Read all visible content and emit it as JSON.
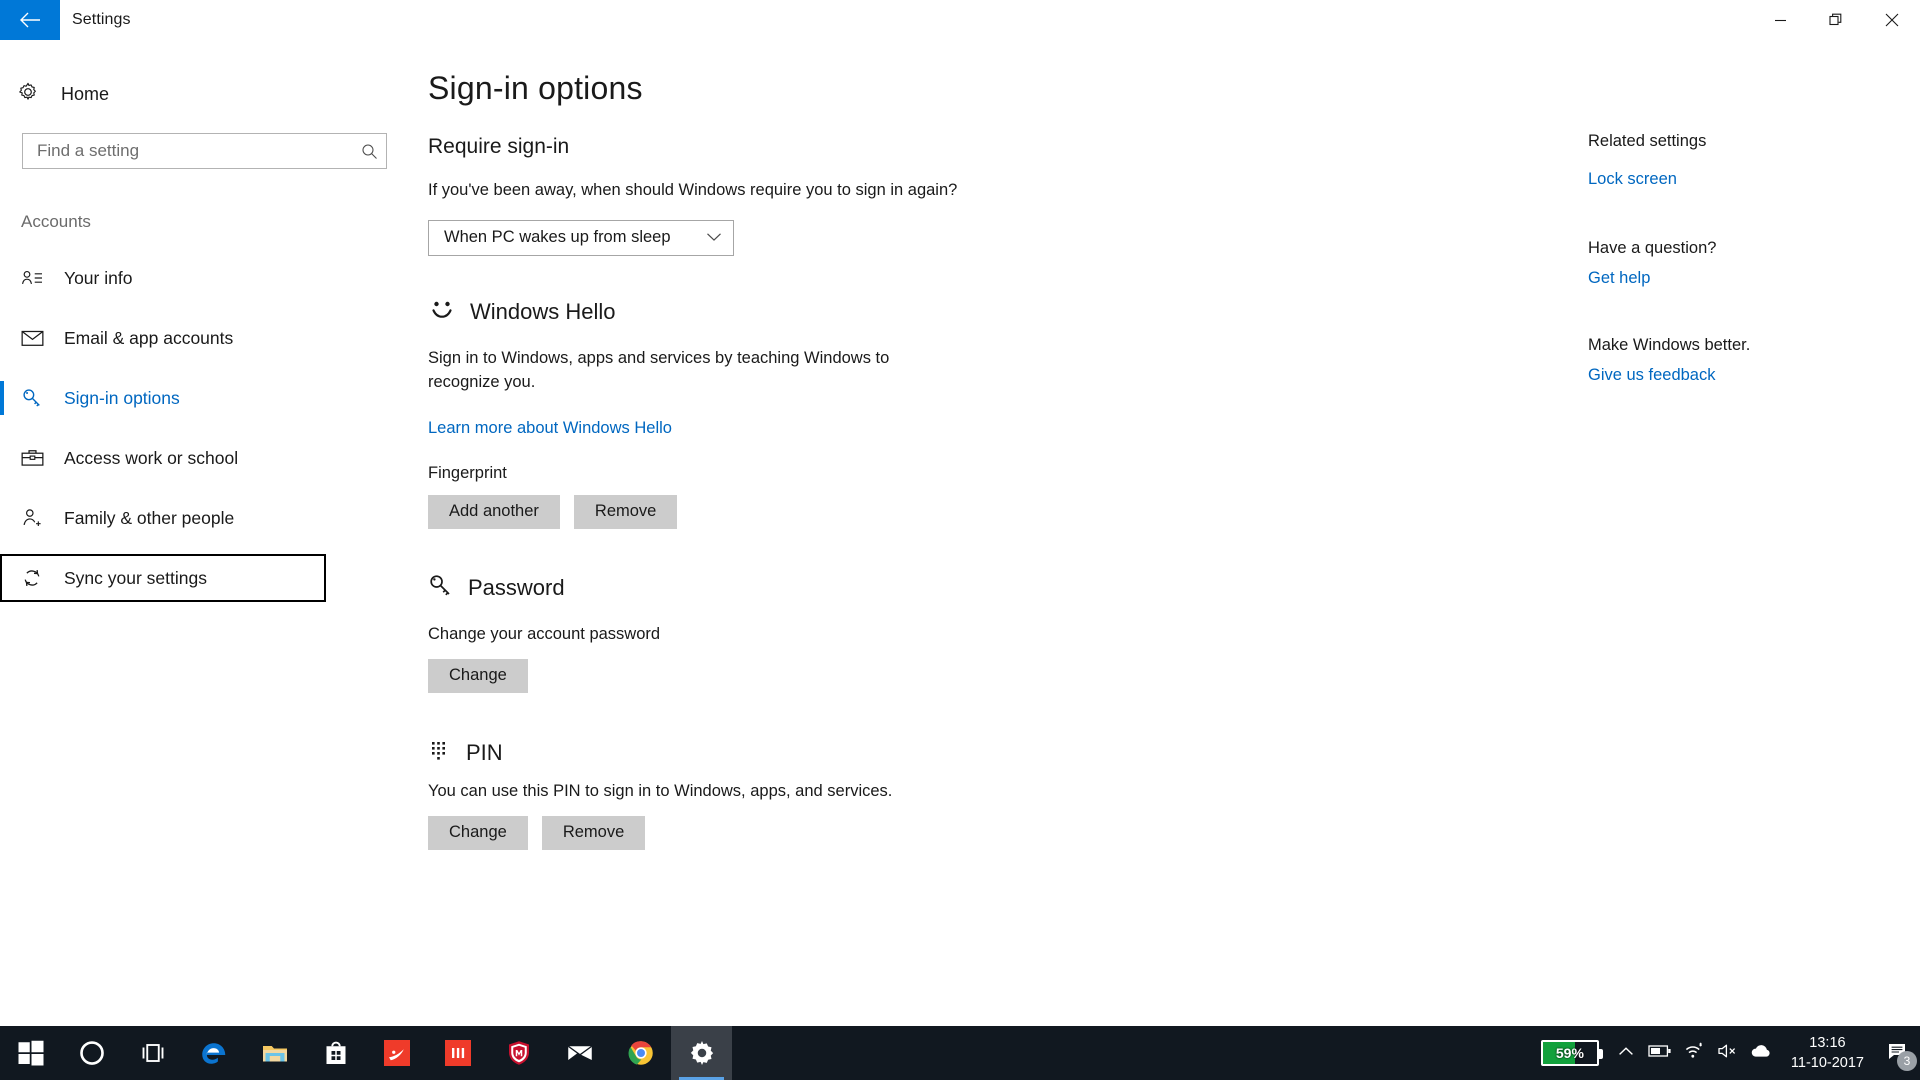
{
  "window": {
    "title": "Settings",
    "back_icon": "back-arrow-icon",
    "controls": {
      "minimize": "minimize-icon",
      "restore": "restore-icon",
      "close": "close-icon"
    },
    "accent_color": "#0078d7"
  },
  "sidebar": {
    "home_label": "Home",
    "search": {
      "placeholder": "Find a setting",
      "value": ""
    },
    "section_label": "Accounts",
    "items": [
      {
        "label": "Your info",
        "icon": "contact-card-icon",
        "active": false,
        "focused": false
      },
      {
        "label": "Email & app accounts",
        "icon": "envelope-icon",
        "active": false,
        "focused": false
      },
      {
        "label": "Sign-in options",
        "icon": "key-icon",
        "active": true,
        "focused": false
      },
      {
        "label": "Access work or school",
        "icon": "briefcase-icon",
        "active": false,
        "focused": false
      },
      {
        "label": "Family & other people",
        "icon": "person-add-icon",
        "active": false,
        "focused": false
      },
      {
        "label": "Sync your settings",
        "icon": "sync-refresh-icon",
        "active": false,
        "focused": true
      }
    ]
  },
  "main": {
    "page_title": "Sign-in options",
    "require_signin": {
      "heading": "Require sign-in",
      "description": "If you've been away, when should Windows require you to sign in again?",
      "dropdown_value": "When PC wakes up from sleep"
    },
    "windows_hello": {
      "heading": "Windows Hello",
      "icon": "smiley-face-icon",
      "description": "Sign in to Windows, apps and services by teaching Windows to recognize you.",
      "link": "Learn more about Windows Hello",
      "fingerprint_label": "Fingerprint",
      "add_button": "Add another",
      "remove_button": "Remove"
    },
    "password": {
      "heading": "Password",
      "icon": "key-icon",
      "description": "Change your account password",
      "change_button": "Change"
    },
    "pin": {
      "heading": "PIN",
      "icon": "keypad-dots-icon",
      "description": "You can use this PIN to sign in to Windows, apps, and services.",
      "change_button": "Change",
      "remove_button": "Remove"
    }
  },
  "rail": {
    "related_settings_heading": "Related settings",
    "lock_screen_link": "Lock screen",
    "question_heading": "Have a question?",
    "get_help_link": "Get help",
    "feedback_heading": "Make Windows better.",
    "feedback_link": "Give us feedback"
  },
  "taskbar": {
    "apps": [
      {
        "name": "start-button",
        "icon": "windows-logo-icon"
      },
      {
        "name": "cortana-button",
        "icon": "circle-icon"
      },
      {
        "name": "task-view-button",
        "icon": "task-view-icon"
      },
      {
        "name": "edge-taskbar-icon",
        "icon": "edge-icon"
      },
      {
        "name": "file-explorer-taskbar-icon",
        "icon": "folder-icon"
      },
      {
        "name": "microsoft-store-taskbar-icon",
        "icon": "store-bag-icon"
      },
      {
        "name": "red-app-one-taskbar-icon",
        "icon": "red-swoosh-icon"
      },
      {
        "name": "red-app-two-taskbar-icon",
        "icon": "red-bars-icon"
      },
      {
        "name": "mcafee-taskbar-icon",
        "icon": "shield-icon"
      },
      {
        "name": "mail-taskbar-icon",
        "icon": "envelope-icon"
      },
      {
        "name": "chrome-taskbar-icon",
        "icon": "chrome-icon"
      },
      {
        "name": "settings-taskbar-icon",
        "icon": "gear-icon",
        "active": true
      }
    ],
    "tray": {
      "battery_percent": "59%",
      "battery_level": 59,
      "show_hidden_icon": "chevron-up-icon",
      "battery_icon": "battery-icon",
      "network_icon": "wifi-icon",
      "volume_icon": "speaker-muted-icon",
      "onedrive_icon": "cloud-icon",
      "time": "13:16",
      "date": "11-10-2017",
      "action_center_icon": "action-center-icon",
      "action_center_badge": "3"
    }
  }
}
